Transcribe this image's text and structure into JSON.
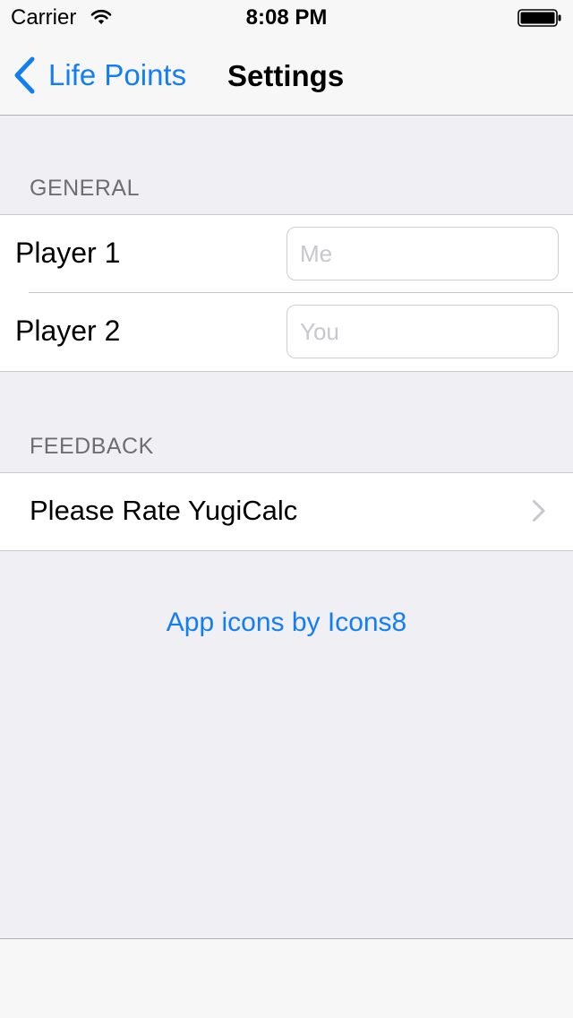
{
  "status_bar": {
    "carrier": "Carrier",
    "time": "8:08 PM"
  },
  "nav": {
    "back_label": "Life Points",
    "title": "Settings"
  },
  "sections": {
    "general": {
      "header": "GENERAL",
      "rows": [
        {
          "label": "Player 1",
          "value": "",
          "placeholder": "Me"
        },
        {
          "label": "Player 2",
          "value": "",
          "placeholder": "You"
        }
      ]
    },
    "feedback": {
      "header": "FEEDBACK",
      "rate_label": "Please Rate YugiCalc"
    }
  },
  "credits": {
    "link_label": "App icons by Icons8"
  },
  "colors": {
    "tint": "#127ef4",
    "background": "#efeff4",
    "section_header": "#6d6d72",
    "separator": "#c8c7cc",
    "placeholder": "#c7c7cd"
  },
  "icons": [
    "wifi-icon",
    "battery-icon",
    "back-chevron-icon",
    "chevron-right-icon"
  ]
}
